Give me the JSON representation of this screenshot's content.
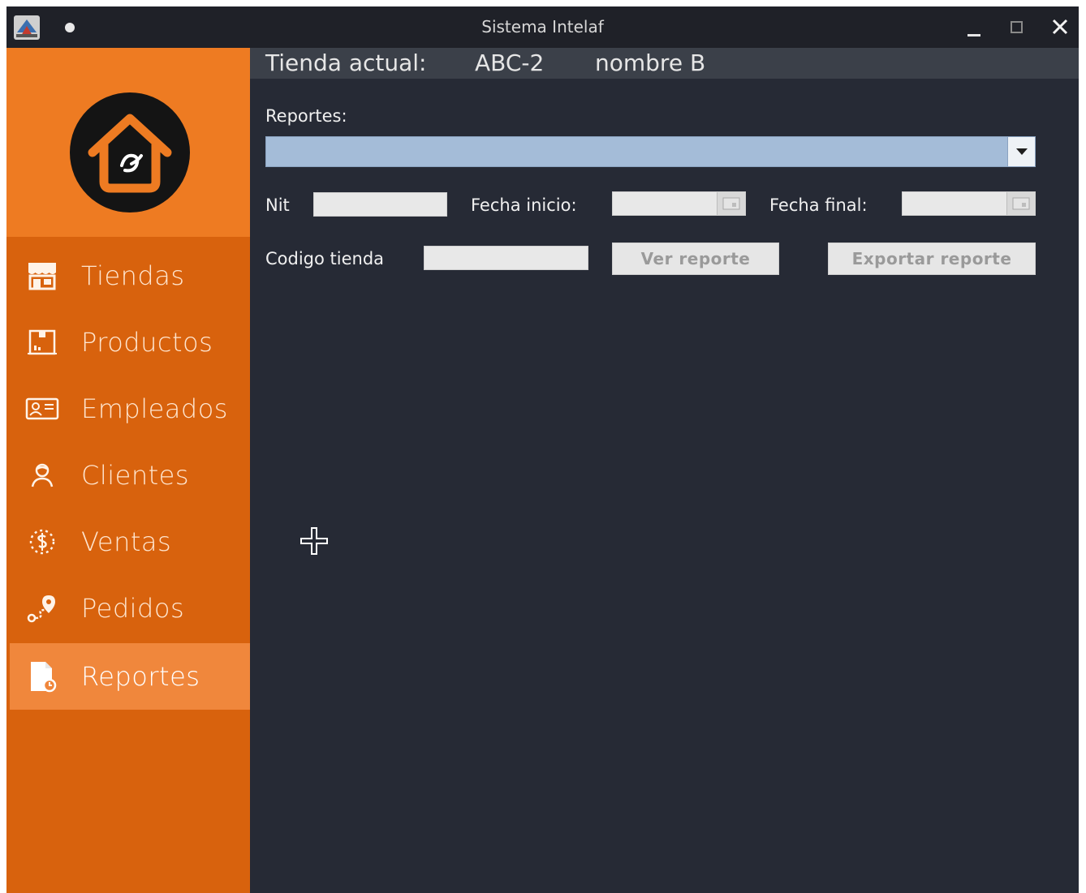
{
  "window": {
    "title": "Sistema Intelaf"
  },
  "header": {
    "store_label": "Tienda actual:",
    "store_code": "ABC-2",
    "store_name": "nombre B"
  },
  "sidebar": {
    "items": [
      {
        "label": "Tiendas",
        "icon": "store-icon",
        "active": false
      },
      {
        "label": "Productos",
        "icon": "box-icon",
        "active": false
      },
      {
        "label": "Empleados",
        "icon": "id-card-icon",
        "active": false
      },
      {
        "label": "Clientes",
        "icon": "user-icon",
        "active": false
      },
      {
        "label": "Ventas",
        "icon": "money-icon",
        "active": false
      },
      {
        "label": "Pedidos",
        "icon": "route-pin-icon",
        "active": false
      },
      {
        "label": "Reportes",
        "icon": "report-icon",
        "active": true
      }
    ]
  },
  "form": {
    "reports_label": "Reportes:",
    "report_selected": "",
    "nit_label": "Nit",
    "nit_value": "",
    "start_date_label": "Fecha inicio:",
    "start_date_value": "",
    "end_date_label": "Fecha final:",
    "end_date_value": "",
    "store_code_label": "Codigo tienda",
    "store_code_value": "",
    "view_button": "Ver reporte",
    "export_button": "Exportar reporte"
  },
  "colors": {
    "sidebar": "#d8620d",
    "logo_area": "#ee7b22",
    "active_item": "#f0873c",
    "content_bg": "#262a35",
    "header_bg": "#3b4049",
    "combo_bg": "#a4bcd8"
  }
}
